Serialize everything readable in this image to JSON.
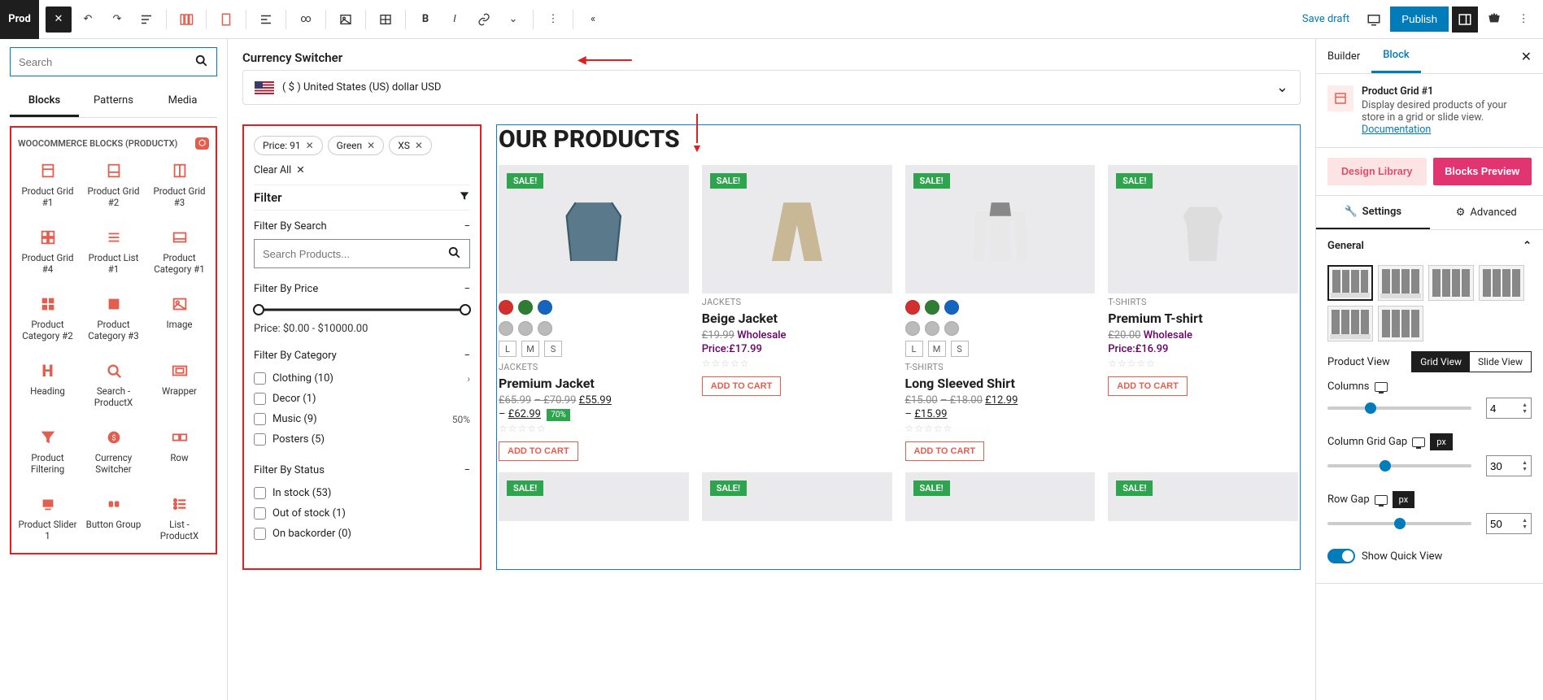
{
  "toolbar": {
    "logo": "Prod",
    "save_draft": "Save draft",
    "publish": "Publish"
  },
  "left": {
    "search_placeholder": "Search",
    "tabs": {
      "blocks": "Blocks",
      "patterns": "Patterns",
      "media": "Media"
    },
    "section_title": "WOOCOMMERCE BLOCKS (PRODUCTX)",
    "items": [
      "Product Grid #1",
      "Product Grid #2",
      "Product Grid #3",
      "Product Grid #4",
      "Product List #1",
      "Product Category #1",
      "Product Category #2",
      "Product Category #3",
      "Image",
      "Heading",
      "Search - ProductX",
      "Wrapper",
      "Product Filtering",
      "Currency Switcher",
      "Row",
      "Product Slider 1",
      "Button Group",
      "List - ProductX"
    ]
  },
  "canvas": {
    "currency_label": "Currency Switcher",
    "currency_value": "( $ ) United States (US) dollar USD",
    "filter": {
      "tags": [
        "Price: 91",
        "Green",
        "XS"
      ],
      "clear_all": "Clear All",
      "title": "Filter",
      "by_search": "Filter By Search",
      "search_placeholder": "Search Products...",
      "by_price": "Filter By Price",
      "price_text": "Price: $0.00 - $10000.00",
      "by_category": "Filter By Category",
      "categories": [
        {
          "label": "Clothing (10)",
          "has_children": true
        },
        {
          "label": "Decor (1)"
        },
        {
          "label": "Music (9)",
          "pct": "50%"
        },
        {
          "label": "Posters (5)"
        }
      ],
      "by_status": "Filter By Status",
      "statuses": [
        {
          "label": "In stock (53)"
        },
        {
          "label": "Out of stock (1)"
        },
        {
          "label": "On backorder (0)"
        }
      ]
    },
    "products": {
      "heading": "OUR PRODUCTS",
      "sale": "SALE!",
      "add_to_cart": "ADD TO CART",
      "items": [
        {
          "colors": [
            "#d32f2f",
            "#2e7d32",
            "#1565c0"
          ],
          "muted_swatches": true,
          "sizes": [
            "L",
            "M",
            "S"
          ],
          "cat": "JACKETS",
          "name": "Premium Jacket",
          "old": "£65.99",
          "dash": "–",
          "old2": "£70.99",
          "new": "£55.99",
          "dash2": "–",
          "new2": "£62.99",
          "discount": "70%",
          "stars": "☆☆☆☆☆"
        },
        {
          "cat": "JACKETS",
          "name": "Beige Jacket",
          "old": "£19.99",
          "wholesale_lbl": "Wholesale",
          "wholesale_price": "Price:£17.99",
          "stars": "☆☆☆☆☆"
        },
        {
          "colors": [
            "#d32f2f",
            "#2e7d32",
            "#1565c0"
          ],
          "muted_swatches": true,
          "sizes": [
            "L",
            "M",
            "S"
          ],
          "cat": "T-SHIRTS",
          "name": "Long Sleeved Shirt",
          "old": "£15.00",
          "dash": "–",
          "old2": "£18.00",
          "new": "£12.99",
          "dash2": "–",
          "new2": "£15.99",
          "stars": "☆☆☆☆☆"
        },
        {
          "cat": "T-SHIRTS",
          "name": "Premium T-shirt",
          "old": "£20.00",
          "wholesale_lbl": "Wholesale",
          "wholesale_price": "Price:£16.99",
          "stars": "☆☆☆☆☆"
        }
      ]
    }
  },
  "right": {
    "tabs": {
      "builder": "Builder",
      "block": "Block"
    },
    "block_name": "Product Grid #1",
    "block_desc": "Display desired products of your store in a grid or slide view.",
    "documentation": "Documentation",
    "design_library": "Design Library",
    "blocks_preview": "Blocks Preview",
    "settings_tabs": {
      "settings": "Settings",
      "advanced": "Advanced"
    },
    "general": {
      "title": "General",
      "product_view": "Product View",
      "grid_view": "Grid View",
      "slide_view": "Slide View",
      "columns": "Columns",
      "columns_val": "4",
      "col_grid_gap": "Column Grid Gap",
      "col_grid_gap_val": "30",
      "row_gap": "Row Gap",
      "row_gap_val": "50",
      "px": "px",
      "show_quick": "Show Quick View"
    }
  }
}
